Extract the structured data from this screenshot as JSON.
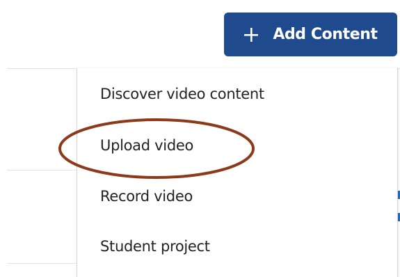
{
  "toolbar": {
    "add_content_label": "Add Content",
    "add_icon": "plus-icon",
    "accent_color": "#1f4b8e"
  },
  "menu": {
    "items": [
      {
        "label": "Discover video content"
      },
      {
        "label": "Upload video",
        "highlighted": true
      },
      {
        "label": "Record video"
      },
      {
        "label": "Student project"
      }
    ]
  },
  "annotation": {
    "shape": "ellipse",
    "target": "Upload video",
    "color": "#8b3a1a"
  }
}
